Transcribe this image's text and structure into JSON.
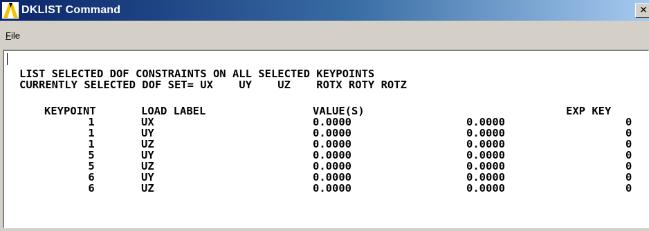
{
  "window": {
    "title": "DKLIST  Command",
    "close_glyph": "✕"
  },
  "menubar": {
    "items": [
      {
        "label": "File"
      }
    ]
  },
  "output": {
    "heading_line1": "LIST SELECTED DOF CONSTRAINTS ON ALL SELECTED KEYPOINTS",
    "heading_line2": "CURRENTLY SELECTED DOF SET= UX    UY    UZ    ROTX ROTY ROTZ",
    "table": {
      "headers": {
        "keypoint": "KEYPOINT",
        "load_label": "LOAD LABEL",
        "values": "VALUE(S)",
        "exp_key": "EXP KEY"
      },
      "rows": [
        {
          "keypoint": "1",
          "load_label": "UX",
          "value1": "0.0000",
          "value2": "0.0000",
          "exp_key": "0"
        },
        {
          "keypoint": "1",
          "load_label": "UY",
          "value1": "0.0000",
          "value2": "0.0000",
          "exp_key": "0"
        },
        {
          "keypoint": "1",
          "load_label": "UZ",
          "value1": "0.0000",
          "value2": "0.0000",
          "exp_key": "0"
        },
        {
          "keypoint": "5",
          "load_label": "UY",
          "value1": "0.0000",
          "value2": "0.0000",
          "exp_key": "0"
        },
        {
          "keypoint": "5",
          "load_label": "UZ",
          "value1": "0.0000",
          "value2": "0.0000",
          "exp_key": "0"
        },
        {
          "keypoint": "6",
          "load_label": "UY",
          "value1": "0.0000",
          "value2": "0.0000",
          "exp_key": "0"
        },
        {
          "keypoint": "6",
          "load_label": "UZ",
          "value1": "0.0000",
          "value2": "0.0000",
          "exp_key": "0"
        }
      ]
    }
  },
  "colors": {
    "titlebar_start": "#0a246a",
    "titlebar_end": "#a6caf0",
    "logo_yellow": "#f2c400",
    "logo_black": "#000000",
    "chrome": "#d4d0c8"
  },
  "icons": {
    "app_logo": "ansys-logo-icon",
    "close": "close-icon"
  }
}
